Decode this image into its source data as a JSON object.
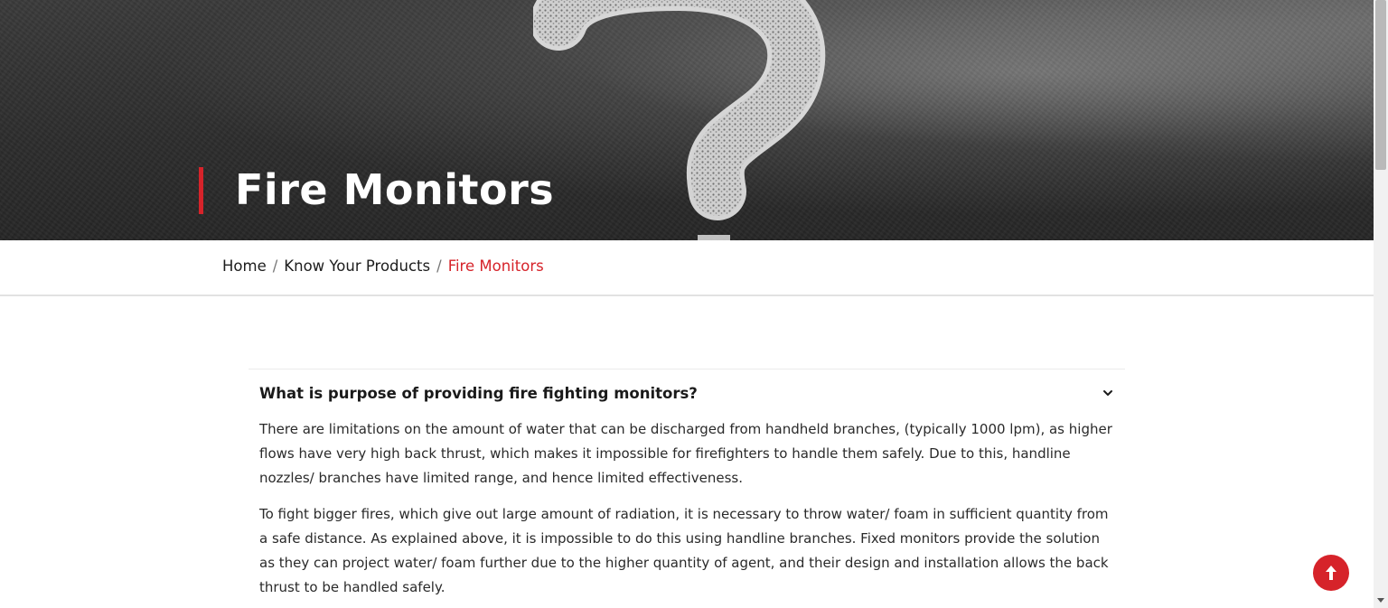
{
  "hero": {
    "title": "Fire Monitors",
    "accent_color": "#d6232a"
  },
  "breadcrumb": {
    "items": [
      {
        "label": "Home"
      },
      {
        "label": "Know Your Products"
      },
      {
        "label": "Fire Monitors"
      }
    ],
    "separator": "/"
  },
  "faq": {
    "question": "What is purpose of providing fire fighting monitors?",
    "expanded": true,
    "answer": [
      "There are limitations on the amount of water that can be discharged from handheld branches, (typically 1000 lpm), as higher flows have very high back thrust, which makes it impossible for firefighters to handle them safely. Due to this, handline nozzles/ branches have limited range, and hence limited effectiveness.",
      "To fight bigger fires, which give out large amount of radiation, it is necessary to throw water/ foam in sufficient quantity from a safe distance. As explained above, it is impossible to do this using handline branches. Fixed monitors provide the solution as they can project water/ foam further due to the higher quantity of agent, and their design and installation allows the back thrust to be handled safely."
    ]
  },
  "icons": {
    "chevron": "chevron-down-icon",
    "scroll_top": "arrow-up-icon"
  },
  "colors": {
    "brand_red": "#d6232a",
    "text": "#1d1d1d"
  }
}
